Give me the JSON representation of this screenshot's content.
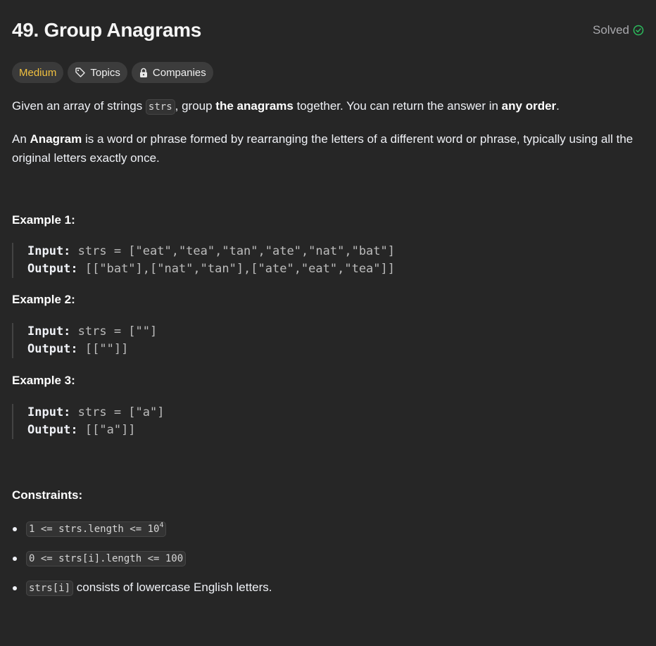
{
  "problem": {
    "title": "49. Group Anagrams",
    "status": "Solved",
    "difficulty": "Medium",
    "tags": {
      "topics": "Topics",
      "companies": "Companies"
    }
  },
  "description": {
    "p1_a": "Given an array of strings ",
    "p1_code": "strs",
    "p1_b": ", group ",
    "p1_bold1": "the anagrams",
    "p1_c": " together. You can return the answer in ",
    "p1_bold2": "any order",
    "p1_d": ".",
    "p2_a": "An ",
    "p2_bold": "Anagram",
    "p2_b": " is a word or phrase formed by rearranging the letters of a different word or phrase, typically using all the original letters exactly once."
  },
  "examples": [
    {
      "title": "Example 1:",
      "input_label": "Input:",
      "input_value": " strs = [\"eat\",\"tea\",\"tan\",\"ate\",\"nat\",\"bat\"]",
      "output_label": "Output:",
      "output_value": " [[\"bat\"],[\"nat\",\"tan\"],[\"ate\",\"eat\",\"tea\"]]"
    },
    {
      "title": "Example 2:",
      "input_label": "Input:",
      "input_value": " strs = [\"\"]",
      "output_label": "Output:",
      "output_value": " [[\"\"]]"
    },
    {
      "title": "Example 3:",
      "input_label": "Input:",
      "input_value": " strs = [\"a\"]",
      "output_label": "Output:",
      "output_value": " [[\"a\"]]"
    }
  ],
  "constraints": {
    "title": "Constraints:",
    "c1_code": "1 <= strs.length <= 10",
    "c1_sup": "4",
    "c2_code": "0 <= strs[i].length <= 100",
    "c3_code": "strs[i]",
    "c3_text": " consists of lowercase English letters."
  },
  "colors": {
    "background": "#262626",
    "medium": "#f0c040",
    "solved_check": "#2cbb5d"
  },
  "icons": {
    "solved": "check-circle-icon",
    "topics": "tag-icon",
    "companies": "lock-icon"
  }
}
